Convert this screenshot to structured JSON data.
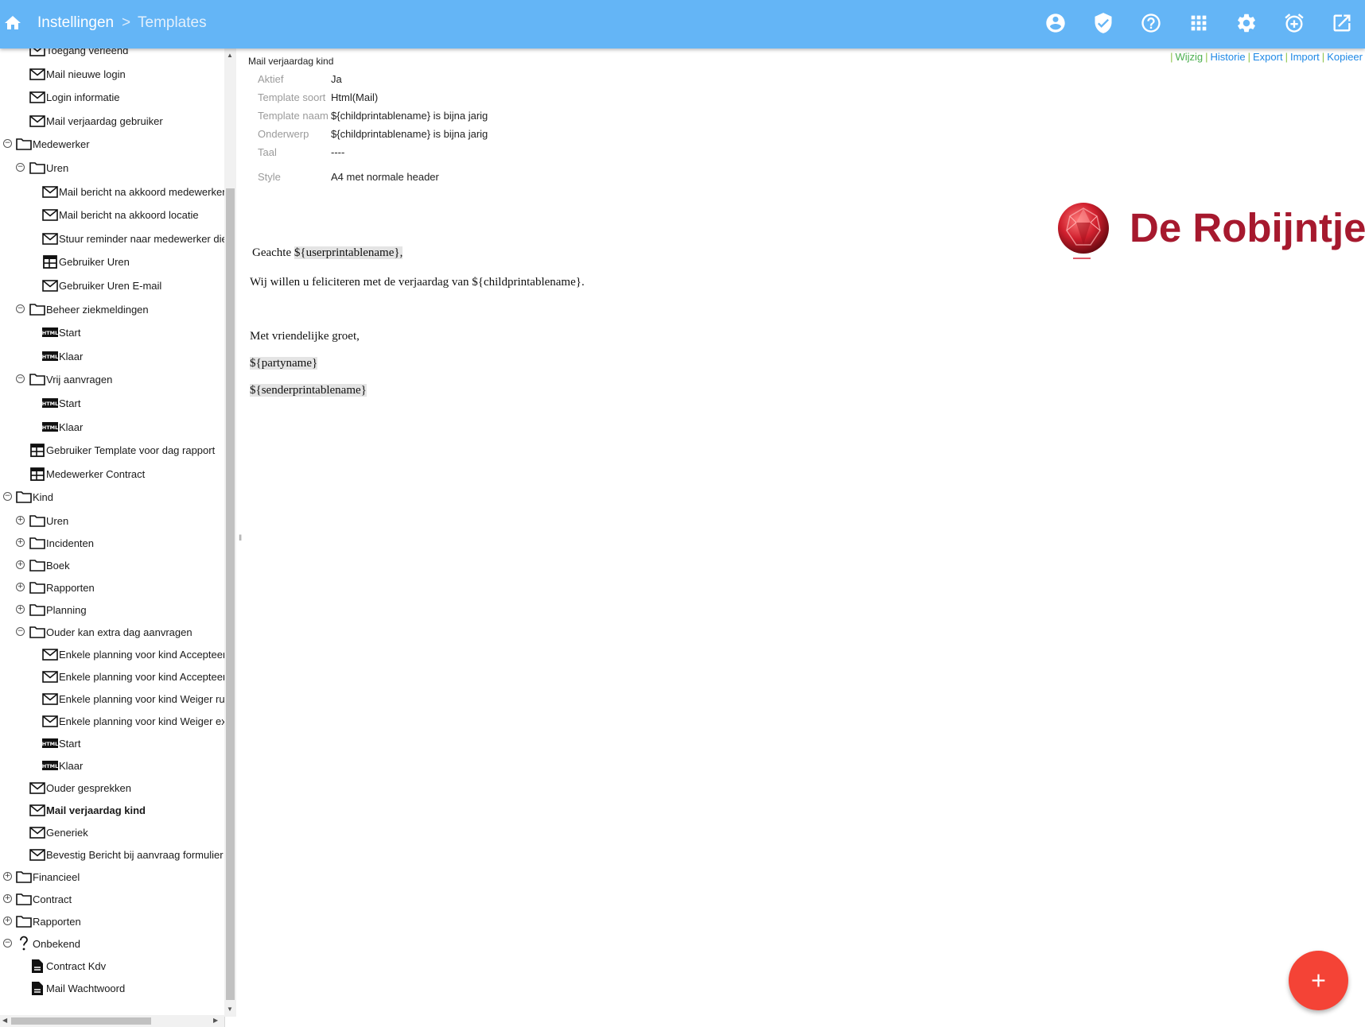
{
  "header": {
    "breadcrumb": [
      "Instellingen",
      "Templates"
    ],
    "separator": ">",
    "icons": [
      "home-icon",
      "account-icon",
      "shield-check-icon",
      "help-icon",
      "apps-grid-icon",
      "settings-icon",
      "alarm-add-icon",
      "open-external-icon"
    ]
  },
  "sidebar": {
    "tree": [
      {
        "label": "Toegang verleend",
        "icon": "mail",
        "level": 2,
        "toggle": null
      },
      {
        "label": "Mail nieuwe login",
        "icon": "mail",
        "level": 2,
        "toggle": null
      },
      {
        "label": "Login informatie",
        "icon": "mail",
        "level": 2,
        "toggle": null
      },
      {
        "label": "Mail verjaardag gebruiker",
        "icon": "mail",
        "level": 2,
        "toggle": null
      },
      {
        "label": "Medewerker",
        "icon": "folder",
        "level": 1,
        "toggle": "minus"
      },
      {
        "label": "Uren",
        "icon": "folder",
        "level": 2,
        "toggle": "minus"
      },
      {
        "label": "Mail bericht na akkoord medewerker",
        "icon": "mail",
        "level": 3,
        "toggle": null
      },
      {
        "label": "Mail bericht na akkoord locatie",
        "icon": "mail",
        "level": 3,
        "toggle": null
      },
      {
        "label": "Stuur reminder naar medewerker die",
        "icon": "mail",
        "level": 3,
        "toggle": null
      },
      {
        "label": "Gebruiker Uren",
        "icon": "table",
        "level": 3,
        "toggle": null
      },
      {
        "label": "Gebruiker Uren E-mail",
        "icon": "mail",
        "level": 3,
        "toggle": null
      },
      {
        "label": "Beheer ziekmeldingen",
        "icon": "folder",
        "level": 2,
        "toggle": "minus"
      },
      {
        "label": "Start",
        "icon": "html",
        "level": 3,
        "toggle": null
      },
      {
        "label": "Klaar",
        "icon": "html",
        "level": 3,
        "toggle": null
      },
      {
        "label": "Vrij aanvragen",
        "icon": "folder",
        "level": 2,
        "toggle": "minus"
      },
      {
        "label": "Start",
        "icon": "html",
        "level": 3,
        "toggle": null
      },
      {
        "label": "Klaar",
        "icon": "html",
        "level": 3,
        "toggle": null
      },
      {
        "label": "Gebruiker Template voor dag rapport",
        "icon": "table",
        "level": 2,
        "toggle": null
      },
      {
        "label": "Medewerker Contract",
        "icon": "table",
        "level": 2,
        "toggle": null
      },
      {
        "label": "Kind",
        "icon": "folder",
        "level": 1,
        "toggle": "minus"
      },
      {
        "label": "Uren",
        "icon": "folder",
        "level": 2,
        "toggle": "plus"
      },
      {
        "label": "Incidenten",
        "icon": "folder",
        "level": 2,
        "toggle": "plus"
      },
      {
        "label": "Boek",
        "icon": "folder",
        "level": 2,
        "toggle": "plus"
      },
      {
        "label": "Rapporten",
        "icon": "folder",
        "level": 2,
        "toggle": "plus"
      },
      {
        "label": "Planning",
        "icon": "folder",
        "level": 2,
        "toggle": "plus"
      },
      {
        "label": "Ouder kan extra dag aanvragen",
        "icon": "folder",
        "level": 2,
        "toggle": "minus"
      },
      {
        "label": "Enkele planning voor kind Accepteer",
        "icon": "mail",
        "level": 3,
        "toggle": null
      },
      {
        "label": "Enkele planning voor kind Accepteer",
        "icon": "mail",
        "level": 3,
        "toggle": null
      },
      {
        "label": "Enkele planning voor kind Weiger ru",
        "icon": "mail",
        "level": 3,
        "toggle": null
      },
      {
        "label": "Enkele planning voor kind Weiger ex",
        "icon": "mail",
        "level": 3,
        "toggle": null
      },
      {
        "label": "Start",
        "icon": "html",
        "level": 3,
        "toggle": null
      },
      {
        "label": "Klaar",
        "icon": "html",
        "level": 3,
        "toggle": null
      },
      {
        "label": "Ouder gesprekken",
        "icon": "mail",
        "level": 2,
        "toggle": null
      },
      {
        "label": "Mail verjaardag kind",
        "icon": "mail",
        "level": 2,
        "toggle": null,
        "selected": true
      },
      {
        "label": "Generiek",
        "icon": "mail",
        "level": 2,
        "toggle": null
      },
      {
        "label": "Bevestig Bericht bij aanvraag formulier",
        "icon": "mail",
        "level": 2,
        "toggle": null
      },
      {
        "label": "Financieel",
        "icon": "folder",
        "level": 1,
        "toggle": "plus"
      },
      {
        "label": "Contract",
        "icon": "folder",
        "level": 1,
        "toggle": "plus"
      },
      {
        "label": "Rapporten",
        "icon": "folder",
        "level": 1,
        "toggle": "plus"
      },
      {
        "label": "Onbekend",
        "icon": "question",
        "level": 1,
        "toggle": "minus"
      },
      {
        "label": "Contract Kdv",
        "icon": "file",
        "level": 2,
        "toggle": null
      },
      {
        "label": "Mail Wachtwoord",
        "icon": "file",
        "level": 2,
        "toggle": null
      }
    ]
  },
  "main": {
    "title": "Mail verjaardag kind",
    "actions": [
      "Wijzig",
      "Historie",
      "Export",
      "Import",
      "Kopieer"
    ],
    "properties": [
      {
        "key": "Aktief",
        "value": "Ja"
      },
      {
        "key": "Template soort",
        "value": "Html(Mail)"
      },
      {
        "key": "Template naam",
        "value": "${childprintablename} is bijna jarig"
      },
      {
        "key": "Onderwerp",
        "value": "${childprintablename} is bijna jarig"
      },
      {
        "key": "Taal",
        "value": "----"
      },
      {
        "key": "Style",
        "value": "A4 met normale header"
      }
    ],
    "logo_text": "De Robijntjes",
    "letter": {
      "greeting": "Geachte ",
      "greeting_field": "${userprintablename},",
      "body": "Wij willen u feliciteren met de verjaardag van ${childprintablename}.",
      "closing": "Met vriendelijke groet,",
      "party_field": "${partyname}",
      "sender_field": "${senderprintablename}"
    },
    "fab_icon": "plus-icon"
  },
  "colors": {
    "topbar": "#64b5f6",
    "action_link": "#1e88e5",
    "action_edit": "#4caf50",
    "fab": "#f44336",
    "logo": "#a6192e"
  }
}
